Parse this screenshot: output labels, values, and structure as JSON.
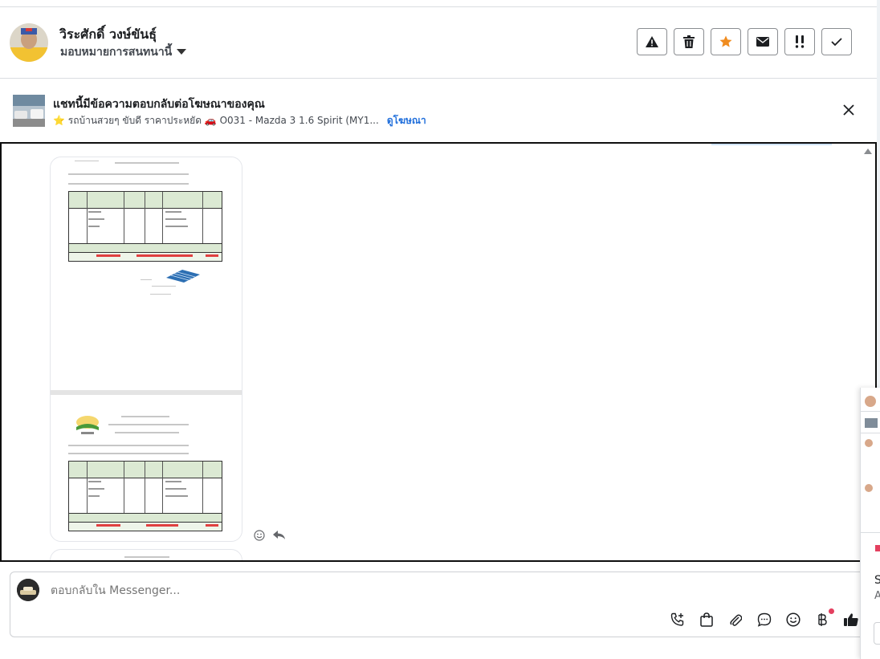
{
  "header": {
    "contact_name": "วิระศักดิ์ วงษ์ขันธุ์",
    "assign_label": "มอบหมายการสนทนานี้",
    "actions": [
      {
        "name": "mark-spam-button",
        "icon": "warning-icon"
      },
      {
        "name": "delete-button",
        "icon": "trash-icon"
      },
      {
        "name": "star-button",
        "icon": "star-icon"
      },
      {
        "name": "mark-unread-button",
        "icon": "envelope-icon"
      },
      {
        "name": "follow-up-button",
        "icon": "double-exclamation-icon"
      },
      {
        "name": "mark-done-button",
        "icon": "check-icon"
      }
    ]
  },
  "ad_banner": {
    "title": "แชทนี้มีข้อความตอบกลับต่อโฆษณาของคุณ",
    "subtitle": "⭐ รถบ้านสวยๆ ขับดี ราคาประหยัด 🚗 O031 - Mazda 3 1.6 Spirit (MY1...",
    "link_label": "ดูโฆษณา"
  },
  "composer": {
    "placeholder": "ตอบกลับใน Messenger..."
  },
  "peek": {
    "letters": [
      "S",
      "A"
    ]
  },
  "colors": {
    "accent_blue": "#216fdb",
    "star_orange": "#f08c1f",
    "border_dark": "#0e0e0e",
    "notification_red": "#e4405f"
  }
}
